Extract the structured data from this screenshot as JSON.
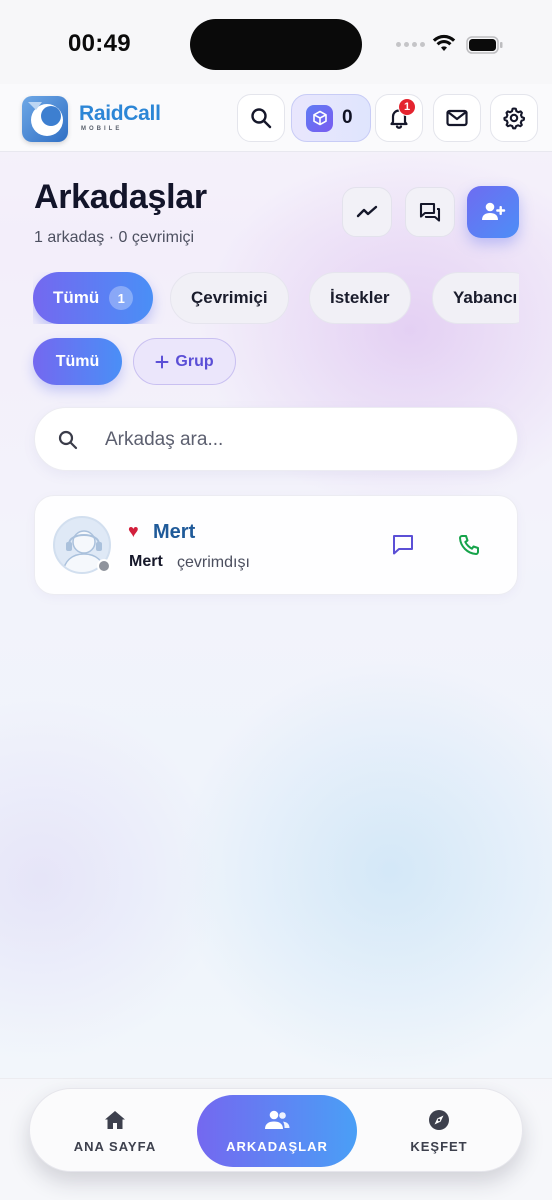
{
  "status_bar": {
    "time": "00:49"
  },
  "header": {
    "brand": "RaidCall",
    "brand_sub": "MOBILE",
    "coins": "0",
    "notification_count": "1",
    "icons": [
      "search-icon",
      "cube-icon",
      "bell-icon",
      "mail-icon",
      "gear-icon"
    ]
  },
  "page": {
    "title": "Arkadaşlar",
    "subtitle": "1 arkadaş · 0 çevrimiçi",
    "actions": [
      "trend-icon",
      "chat-bubbles-icon",
      "add-user-icon"
    ]
  },
  "filters": {
    "tabs": [
      {
        "label": "Tümü",
        "count": "1",
        "active": true
      },
      {
        "label": "Çevrimiçi"
      },
      {
        "label": "İstekler"
      },
      {
        "label": "Yabancı"
      }
    ],
    "groups": {
      "all_label": "Tümü",
      "add_label": "Grup"
    }
  },
  "search": {
    "placeholder": "Arkadaş ara..."
  },
  "friends": [
    {
      "name": "Mert",
      "display": "Mert",
      "status": "çevrimdışı"
    }
  ],
  "bottom_nav": [
    {
      "label": "ANA SAYFA",
      "icon": "home-icon"
    },
    {
      "label": "ARKADAŞLAR",
      "icon": "users-icon",
      "active": true
    },
    {
      "label": "KEŞFET",
      "icon": "compass-icon"
    }
  ],
  "colors": {
    "accent_start": "#7468f0",
    "accent_end": "#4a8ff6",
    "badge": "#e4242f",
    "call_green": "#16a34a"
  }
}
